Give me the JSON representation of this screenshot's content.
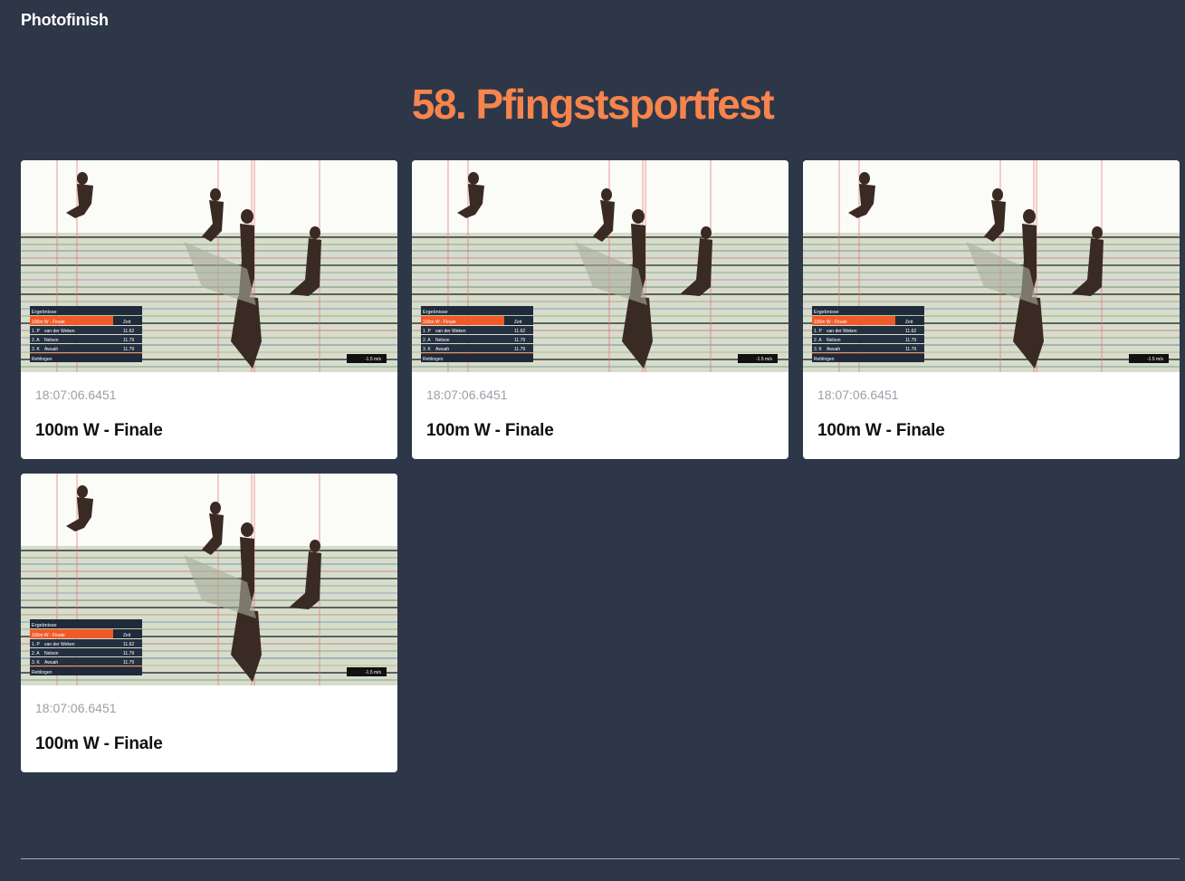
{
  "header": {
    "brand": "Photofinish"
  },
  "page": {
    "title": "58. Pfingstsportfest"
  },
  "colors": {
    "accent": "#f6844c",
    "background": "#2d3748",
    "card": "#ffffff",
    "scoreboard_highlight": "#f05a28"
  },
  "cards": [
    {
      "timestamp": "18:07:06.6451",
      "title": "100m W - Finale",
      "scoreboard": {
        "header": "Ergebnisse",
        "event": "100m W - Finale",
        "time_col": "Zeit",
        "rows": [
          {
            "place": "1. P",
            "name": "van der Weken",
            "time": "11.62"
          },
          {
            "place": "2. A",
            "name": "Nelson",
            "time": "11.79"
          },
          {
            "place": "3. K",
            "name": "Awuah",
            "time": "11.79"
          }
        ],
        "venue": "Rehlingen",
        "wind": "-1.5 m/s"
      }
    },
    {
      "timestamp": "18:07:06.6451",
      "title": "100m W - Finale",
      "scoreboard": {
        "header": "Ergebnisse",
        "event": "100m W - Finale",
        "time_col": "Zeit",
        "rows": [
          {
            "place": "1. P",
            "name": "van der Weken",
            "time": "11.62"
          },
          {
            "place": "2. A",
            "name": "Nelson",
            "time": "11.79"
          },
          {
            "place": "3. K",
            "name": "Awuah",
            "time": "11.79"
          }
        ],
        "venue": "Rehlingen",
        "wind": "-1.5 m/s"
      }
    },
    {
      "timestamp": "18:07:06.6451",
      "title": "100m W - Finale",
      "scoreboard": {
        "header": "Ergebnisse",
        "event": "100m W - Finale",
        "time_col": "Zeit",
        "rows": [
          {
            "place": "1. P",
            "name": "van der Weken",
            "time": "11.62"
          },
          {
            "place": "2. A",
            "name": "Nelson",
            "time": "11.79"
          },
          {
            "place": "3. K",
            "name": "Awuah",
            "time": "11.79"
          }
        ],
        "venue": "Rehlingen",
        "wind": "-1.5 m/s"
      }
    },
    {
      "timestamp": "18:07:06.6451",
      "title": "100m W - Finale",
      "scoreboard": {
        "header": "Ergebnisse",
        "event": "100m W - Finale",
        "time_col": "Zeit",
        "rows": [
          {
            "place": "1. P",
            "name": "van der Weken",
            "time": "11.62"
          },
          {
            "place": "2. A",
            "name": "Nelson",
            "time": "11.79"
          },
          {
            "place": "3. K",
            "name": "Awuah",
            "time": "11.79"
          }
        ],
        "venue": "Rehlingen",
        "wind": "-1.5 m/s"
      }
    }
  ]
}
